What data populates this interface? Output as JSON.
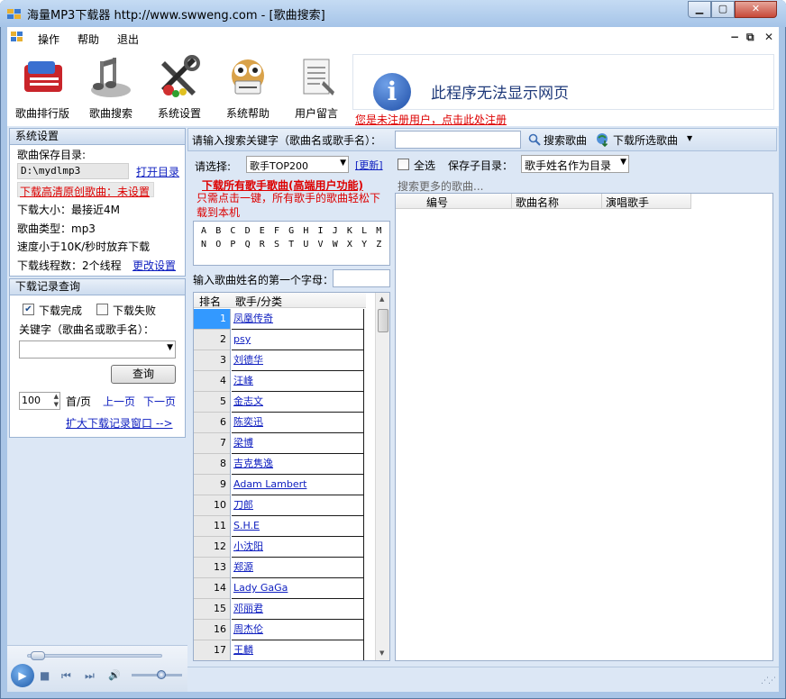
{
  "window": {
    "title": "海量MP3下载器 http://www.swweng.com - [歌曲搜索]",
    "minimize": "▁",
    "maximize": "▢",
    "close": "✕"
  },
  "menu": {
    "ops": "操作",
    "help": "帮助",
    "exit": "退出",
    "mdi_min": "−",
    "mdi_restore": "⧉",
    "mdi_close": "✕"
  },
  "toolbar": {
    "items": [
      {
        "label": "歌曲排行版",
        "icon": "ranking-icon"
      },
      {
        "label": "歌曲搜索",
        "icon": "music-notes-icon"
      },
      {
        "label": "系统设置",
        "icon": "tools-icon"
      },
      {
        "label": "系统帮助",
        "icon": "owl-help-icon"
      },
      {
        "label": "用户留言",
        "icon": "notepad-icon"
      }
    ],
    "ad_text": "此程序无法显示网页",
    "ad_info_glyph": "i",
    "register_link": "您是未注册用户，点击此处注册"
  },
  "settings": {
    "header": "系统设置",
    "save_dir_label": "歌曲保存目录:",
    "save_dir_value": "D:\\mydlmp3",
    "open_dir": "打开目录",
    "hq_link": "下载高清原创歌曲：未设置",
    "size": "下载大小：最接近4M",
    "type": "歌曲类型：mp3",
    "speed": "速度小于10K/秒时放弃下载",
    "threads": "下载线程数：2个线程",
    "change": "更改设置"
  },
  "history": {
    "header": "下载记录查询",
    "done_label": "下载完成",
    "done_checked": true,
    "fail_label": "下载失败",
    "fail_checked": false,
    "keyword_label": "关键字（歌曲名或歌手名）：",
    "keyword_value": "",
    "query_button": "查询",
    "page_size": "100",
    "first_page": "首/页",
    "prev_page": "上一页",
    "next_page": "下一页",
    "expand": "扩大下载记录窗口 -->"
  },
  "player": {
    "play": "▶",
    "stop": "■",
    "prev": "⏮",
    "next": "⏭",
    "volume": "🔊"
  },
  "search": {
    "prompt": "请输入搜索关键字（歌曲名或歌手名）：",
    "value": "",
    "search_button": "搜索歌曲",
    "download_selected": "下载所选歌曲"
  },
  "filter": {
    "select_label": "请选择:",
    "category": "歌手TOP200",
    "update": "[更新]",
    "select_all": "全选",
    "subdir_label": "保存子目录：",
    "subdir_value": "歌手姓名作为目录"
  },
  "promo": {
    "title": "下载所有歌手歌曲(高端用户功能)",
    "desc": "只需点击一键，所有歌手的歌曲轻松下载到本机"
  },
  "letters": {
    "row1": [
      "A",
      "B",
      "C",
      "D",
      "E",
      "F",
      "G",
      "H",
      "I",
      "J",
      "K",
      "L",
      "M"
    ],
    "row2": [
      "N",
      "O",
      "P",
      "Q",
      "R",
      "S",
      "T",
      "U",
      "V",
      "W",
      "X",
      "Y",
      "Z"
    ]
  },
  "initial_input": {
    "label": "输入歌曲姓名的第一个字母：",
    "value": ""
  },
  "rank_list": {
    "col_rank": "排名",
    "col_artist": "歌手/分类",
    "selected_index": 0,
    "rows": [
      {
        "rank": "1",
        "name": "凤凰传奇"
      },
      {
        "rank": "2",
        "name": "psy"
      },
      {
        "rank": "3",
        "name": "刘德华"
      },
      {
        "rank": "4",
        "name": "汪峰"
      },
      {
        "rank": "5",
        "name": "金志文"
      },
      {
        "rank": "6",
        "name": "陈奕迅"
      },
      {
        "rank": "7",
        "name": "梁博"
      },
      {
        "rank": "8",
        "name": "吉克隽逸"
      },
      {
        "rank": "9",
        "name": "Adam Lambert"
      },
      {
        "rank": "10",
        "name": "刀郎"
      },
      {
        "rank": "11",
        "name": "S.H.E"
      },
      {
        "rank": "12",
        "name": "小沈阳"
      },
      {
        "rank": "13",
        "name": "郑源"
      },
      {
        "rank": "14",
        "name": "Lady GaGa"
      },
      {
        "rank": "15",
        "name": "邓丽君"
      },
      {
        "rank": "16",
        "name": "周杰伦"
      },
      {
        "rank": "17",
        "name": "王麟"
      }
    ]
  },
  "songs": {
    "more_label": "搜索更多的歌曲...",
    "col_no": "编号",
    "col_title": "歌曲名称",
    "col_artist": "演唱歌手"
  }
}
